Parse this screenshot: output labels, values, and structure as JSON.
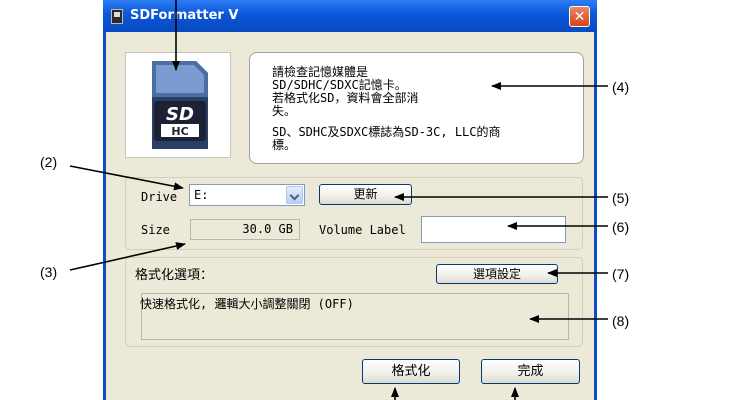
{
  "window": {
    "title": "SDFormatter V",
    "close_glyph": "✕"
  },
  "info": {
    "lines": [
      "請檢查記憶媒體是",
      "SD/SDHC/SDXC記憶卡。",
      "若格式化SD，資料會全部消",
      "失。"
    ],
    "trademark_lines": [
      "SD、SDHC及SDXC標誌為SD-3C, LLC的商",
      "標。"
    ]
  },
  "drive": {
    "label": "Drive",
    "selected": "E:",
    "refresh_label": "更新"
  },
  "size": {
    "label": "Size",
    "value": "30.0 GB"
  },
  "volume": {
    "label": "Volume Label",
    "value": ""
  },
  "options": {
    "heading": "格式化選項：",
    "settings_label": "選項設定",
    "summary": "快速格式化, 邏輯大小調整關閉 (OFF)"
  },
  "actions": {
    "format_label": "格式化",
    "done_label": "完成"
  },
  "logo": {
    "lines": [
      "SD",
      "HC"
    ]
  },
  "annotations": [
    "(2)",
    "(3)",
    "(4)",
    "(5)",
    "(6)",
    "(7)",
    "(8)"
  ],
  "colors": {
    "titlebar": "#0b56d8",
    "dialog_bg": "#ece9d8",
    "close_button": "#d64315"
  }
}
